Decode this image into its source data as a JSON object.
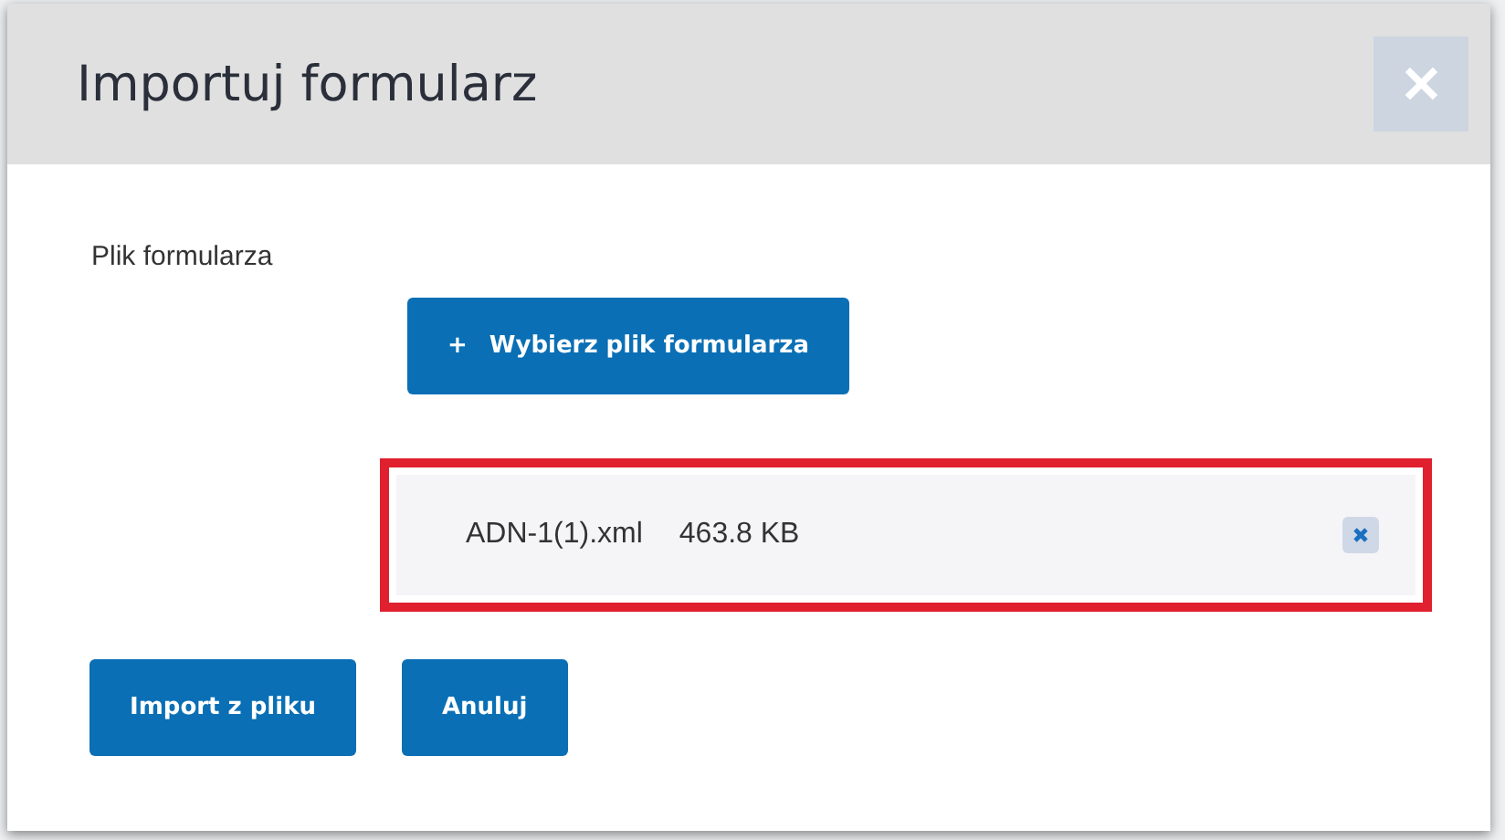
{
  "dialog": {
    "title": "Importuj formularz",
    "close_label": "✕"
  },
  "field": {
    "label": "Plik formularza",
    "choose_button": {
      "icon": "+",
      "label": "Wybierz plik formularza"
    }
  },
  "files": [
    {
      "name": "ADN-1(1).xml",
      "size": "463.8 KB",
      "highlighted": true
    }
  ],
  "buttons": [
    "Import z pliku",
    "Anuluj"
  ]
}
